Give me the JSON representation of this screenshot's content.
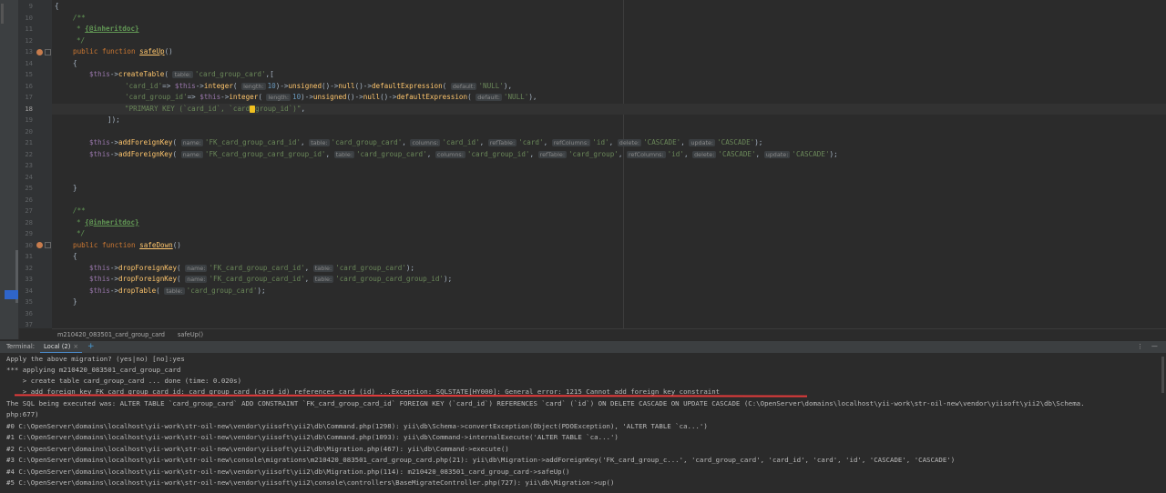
{
  "editor": {
    "line_numbers": [
      "9",
      "10",
      "11",
      "12",
      "13",
      "14",
      "15",
      "16",
      "17",
      "18",
      "19",
      "20",
      "21",
      "22",
      "23",
      "24",
      "25",
      "26",
      "27",
      "28",
      "29",
      "30",
      "31",
      "32",
      "33",
      "34",
      "35",
      "36",
      "37"
    ],
    "current_line": "18",
    "code": {
      "l9": "{",
      "l10": "/**",
      "l11_star": "*",
      "l11_tag": "{@inheritdoc}",
      "l12": "*/",
      "l13_kw": "public function",
      "l13_fn": "safeUp",
      "l13_rest": "()",
      "l14": "{",
      "l15_var": "$this",
      "l15_arrow": "->",
      "l15_fn": "createTable",
      "l15_hint": "table:",
      "l15_str": "'card_group_card'",
      "l15_rest": ",[",
      "l16_str": "'card_id'",
      "l16_op": "=> ",
      "l16_var": "$this",
      "l16_fn": "integer",
      "l16_hint": "length:",
      "l16_num": "10",
      "l16_fn2": "unsigned",
      "l16_fn3": "null",
      "l16_fn4": "defaultExpression",
      "l16_hint2": "default:",
      "l16_str2": "'NULL'",
      "l17_str": "'card_group_id'",
      "l17_op": "=> ",
      "l17_var": "$this",
      "l17_fn": "integer",
      "l17_hint": "length:",
      "l17_num": "10",
      "l17_fn2": "unsigned",
      "l17_fn3": "null",
      "l17_fn4": "defaultExpression",
      "l17_hint2": "default:",
      "l17_str2": "'NULL'",
      "l18_str_a": "\"PRIMARY KEY (`card_id`, `card",
      "l18_str_b": "group_id`)\"",
      "l19": "]);",
      "l21_var": "$this",
      "l21_fn": "addForeignKey",
      "l21_h1": "name:",
      "l21_s1": "'FK_card_group_card_id'",
      "l21_h2": "table:",
      "l21_s2": "'card_group_card'",
      "l21_h3": "columns:",
      "l21_s3": "'card_id'",
      "l21_h4": "refTable:",
      "l21_s4": "'card'",
      "l21_h5": "refColumns:",
      "l21_s5": "'id'",
      "l21_h6": "delete:",
      "l21_s6": "'CASCADE'",
      "l21_h7": "update:",
      "l21_s7": "'CASCADE'",
      "l22_var": "$this",
      "l22_fn": "addForeignKey",
      "l22_h1": "name:",
      "l22_s1": "'FK_card_group_card_group_id'",
      "l22_h2": "table:",
      "l22_s2": "'card_group_card'",
      "l22_h3": "columns:",
      "l22_s3": "'card_group_id'",
      "l22_h4": "refTable:",
      "l22_s4": "'card_group'",
      "l22_h5": "refColumns:",
      "l22_s5": "'id'",
      "l22_h6": "delete:",
      "l22_s6": "'CASCADE'",
      "l22_h7": "update:",
      "l22_s7": "'CASCADE'",
      "l25": "}",
      "l27": "/**",
      "l28_star": "*",
      "l28_tag": "{@inheritdoc}",
      "l29": "*/",
      "l30_kw": "public function",
      "l30_fn": "safeDown",
      "l30_rest": "()",
      "l31": "{",
      "l32_var": "$this",
      "l32_fn": "dropForeignKey",
      "l32_h1": "name:",
      "l32_s1": "'FK_card_group_card_id'",
      "l32_h2": "table:",
      "l32_s2": "'card_group_card'",
      "l33_var": "$this",
      "l33_fn": "dropForeignKey",
      "l33_h1": "name:",
      "l33_s1": "'FK_card_group_card_id'",
      "l33_h2": "table:",
      "l33_s2": "'card_group_card_group_id'",
      "l34_var": "$this",
      "l34_fn": "dropTable",
      "l34_h1": "table:",
      "l34_s1": "'card_group_card'",
      "l35": "}"
    }
  },
  "breadcrumbs": [
    "m210420_083501_card_group_card",
    "safeUp()"
  ],
  "terminal_header": {
    "title": "Terminal:",
    "tab_label": "Local (2)",
    "tab_close": "×",
    "add": "+",
    "more": "⋮",
    "minimize": "—"
  },
  "terminal": {
    "lines": [
      "Apply the above migration? (yes|no) [no]:yes",
      "*** applying m210420_083501_card_group_card",
      "    > create table card_group_card ... done (time: 0.020s)",
      "    > add foreign key FK_card_group_card_id: card_group_card (card_id) references card (id) ...Exception: SQLSTATE[HY000]: General error: 1215 Cannot add foreign key constraint",
      "The SQL being executed was: ALTER TABLE `card_group_card` ADD CONSTRAINT `FK_card_group_card_id` FOREIGN KEY (`card_id`) REFERENCES `card` (`id`) ON DELETE CASCADE ON UPDATE CASCADE (C:\\OpenServer\\domains\\localhost\\yii-work\\str-oil-new\\vendor\\yiisoft\\yii2\\db\\Schema.",
      "php:677)",
      "#0 C:\\OpenServer\\domains\\localhost\\yii-work\\str-oil-new\\vendor\\yiisoft\\yii2\\db\\Command.php(1298): yii\\db\\Schema->convertException(Object(PDOException), 'ALTER TABLE `ca...')",
      "#1 C:\\OpenServer\\domains\\localhost\\yii-work\\str-oil-new\\vendor\\yiisoft\\yii2\\db\\Command.php(1093): yii\\db\\Command->internalExecute('ALTER TABLE `ca...')",
      "#2 C:\\OpenServer\\domains\\localhost\\yii-work\\str-oil-new\\vendor\\yiisoft\\yii2\\db\\Migration.php(467): yii\\db\\Command->execute()",
      "#3 C:\\OpenServer\\domains\\localhost\\yii-work\\str-oil-new\\console\\migrations\\m210420_083501_card_group_card.php(21): yii\\db\\Migration->addForeignKey('FK_card_group_c...', 'card_group_card', 'card_id', 'card', 'id', 'CASCADE', 'CASCADE')",
      "#4 C:\\OpenServer\\domains\\localhost\\yii-work\\str-oil-new\\vendor\\yiisoft\\yii2\\db\\Migration.php(114): m210420_083501_card_group_card->safeUp()",
      "#5 C:\\OpenServer\\domains\\localhost\\yii-work\\str-oil-new\\vendor\\yiisoft\\yii2\\console\\controllers\\BaseMigrateController.php(727): yii\\db\\Migration->up()"
    ]
  }
}
